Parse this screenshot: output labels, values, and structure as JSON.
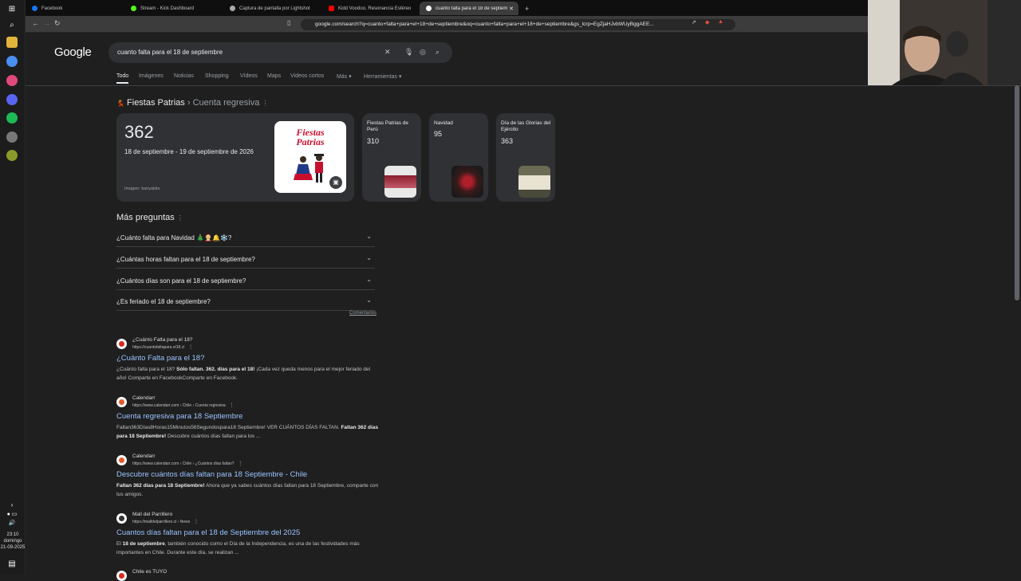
{
  "taskbar": {
    "time": "23:10",
    "day": "domingo",
    "date": "21-09-2025"
  },
  "tabs": [
    {
      "label": "Facebook",
      "color": "#1877f2"
    },
    {
      "label": "Stream - Kick Dashboard",
      "color": "#53fc18"
    },
    {
      "label": "Captura de pantalla por Lightshot",
      "color": "#aaaaaa"
    },
    {
      "label": "Kidd Voodoo, Resonancia Estéreo",
      "color": "#ff0000"
    },
    {
      "label": "cuanto falta para el 18 de septiembre",
      "color": "#ffffff"
    }
  ],
  "address": {
    "url": "google.com/search?q=cuanto+falta+para+el+18+de+septiembre&oq=cuanto+falta+para+el+18+de+septiembre&gs_lcrp=EgZjaHJvbWUyBggAEE..."
  },
  "search": {
    "logo": "Google",
    "query": "cuanto falta para el 18 de septiembre",
    "filters": [
      "Todo",
      "Imágenes",
      "Noticias",
      "Shopping",
      "Vídeos",
      "Maps",
      "Videos cortos",
      "Más",
      "Herramientas"
    ]
  },
  "countdown": {
    "heading": "Fiestas Patrias",
    "subheading": "Cuenta regresiva",
    "days": "362",
    "range": "18 de septiembre - 19 de septiembre de 2026",
    "credit": "Imagen: kanyakits",
    "image_title": "Fiestas Patrias",
    "others": [
      {
        "label": "Fiestas Patrias de Perú",
        "days": "310"
      },
      {
        "label": "Navidad",
        "days": "95"
      },
      {
        "label": "Día de las Glorias del Ejército",
        "days": "363"
      }
    ]
  },
  "paa": {
    "heading": "Más preguntas",
    "items": [
      "¿Cuánto falta para Navidad 🎄🤶🔔❄️?",
      "¿Cuántas horas faltan para el 18 de septiembre?",
      "¿Cuántos días son para el 18 de septiembre?",
      "¿Es feriado el 18 de septiembre?"
    ],
    "comments": "Comentarios"
  },
  "results": [
    {
      "site": "¿Cuánto Falta para el 18?",
      "url": "https://cuantofaltapara el18.cl",
      "title": "¿Cuánto Falta para el 18?",
      "snippet_html": "¿Cuánto falta para el 18? <b>Sólo faltan. 362. días para el 18!</b> ¡Cada vez queda menos para el mejor feriado del año! Comparte en FacebookComparte en Facebook."
    },
    {
      "site": "Calendarr",
      "url": "https://www.calendarr.com › Chile › Cuenta regresiva",
      "title": "Cuenta regresiva para 18 Septiembre",
      "snippet_html": "Faltan363Días8Horas15Minutos56Segundospara18 Septiembre! VER CUÁNTOS DÍAS FALTAN. <b>Faltan 362 días para 18 Septiembre!</b> Descubre cuántos días faltan para los ..."
    },
    {
      "site": "Calendarr",
      "url": "https://www.calendarr.com › Chile › ¿Cuántos días faltan?",
      "title": "Descubre cuántos días faltan para 18 Septiembre - Chile",
      "snippet_html": "<b>Faltan 362 días para 18 Septiembre!</b> Ahora que ya sabes cuántos días faltan para 18 Septiembre, comparte con tus amigos."
    },
    {
      "site": "Mall del Parrillero",
      "url": "https://malldelparrillero.cl › News",
      "title": "Cuantos días faltan para el 18 de Septiembre del 2025",
      "snippet_html": "El <b>18 de septiembre</b>, también conocido como el Día de la Independencia, es una de las festividades más importantes en Chile. Durante este día, se realizan ..."
    },
    {
      "site": "Chile es TUYO",
      "url": "",
      "title": "",
      "snippet_html": ""
    }
  ]
}
